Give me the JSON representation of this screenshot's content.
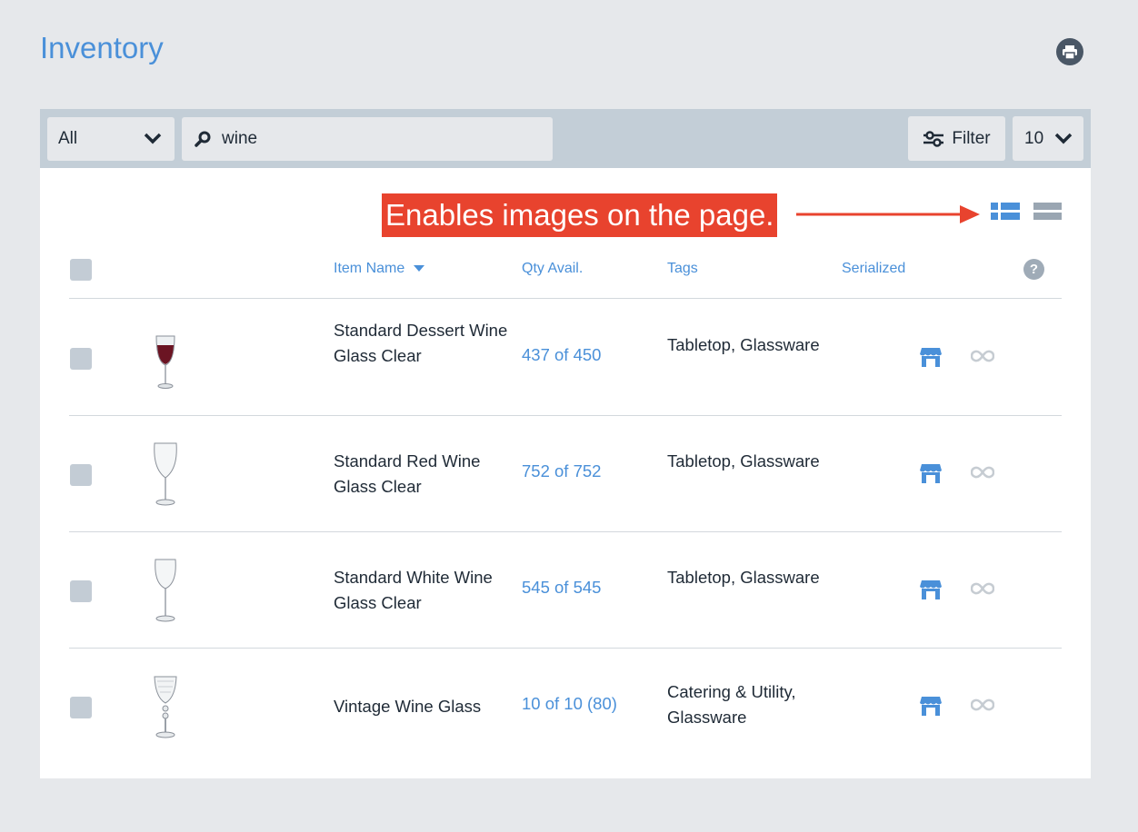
{
  "header": {
    "title": "Inventory",
    "print_icon": "print-icon"
  },
  "toolbar": {
    "scope_value": "All",
    "search_value": "wine",
    "search_icon": "search-icon",
    "filter_label": "Filter",
    "filter_icon": "sliders-icon",
    "per_page_value": "10"
  },
  "annotation": {
    "text": "Enables images on the page."
  },
  "view_toggle": {
    "list_with_images_icon": "list-view-icon",
    "compact_list_icon": "compact-list-icon",
    "active_color": "#4a90d9",
    "inactive_color": "#9aa6b2"
  },
  "table": {
    "columns": {
      "item_name": "Item Name",
      "qty": "Qty Avail.",
      "tags": "Tags",
      "serialized": "Serialized",
      "help": "?"
    },
    "sort_indicator": "caret-down-icon",
    "rows": [
      {
        "name": "Standard Dessert Wine Glass Clear",
        "qty": "437 of 450",
        "tags": "Tabletop, Glassware",
        "image": "dessert-wine-glass-image"
      },
      {
        "name": "Standard Red Wine Glass Clear",
        "qty": "752 of 752",
        "tags": "Tabletop, Glassware",
        "image": "red-wine-glass-image"
      },
      {
        "name": "Standard White Wine Glass Clear",
        "qty": "545 of 545",
        "tags": "Tabletop, Glassware",
        "image": "white-wine-glass-image"
      },
      {
        "name": "Vintage Wine Glass",
        "qty": "10 of 10 (80)",
        "tags": "Catering & Utility, Glassware",
        "image": "vintage-wine-glass-image"
      }
    ]
  },
  "colors": {
    "accent": "#4a90d9",
    "annotation_bg": "#e8432e",
    "toolbar_bg": "#c3ced7",
    "page_bg": "#e6e8eb"
  }
}
